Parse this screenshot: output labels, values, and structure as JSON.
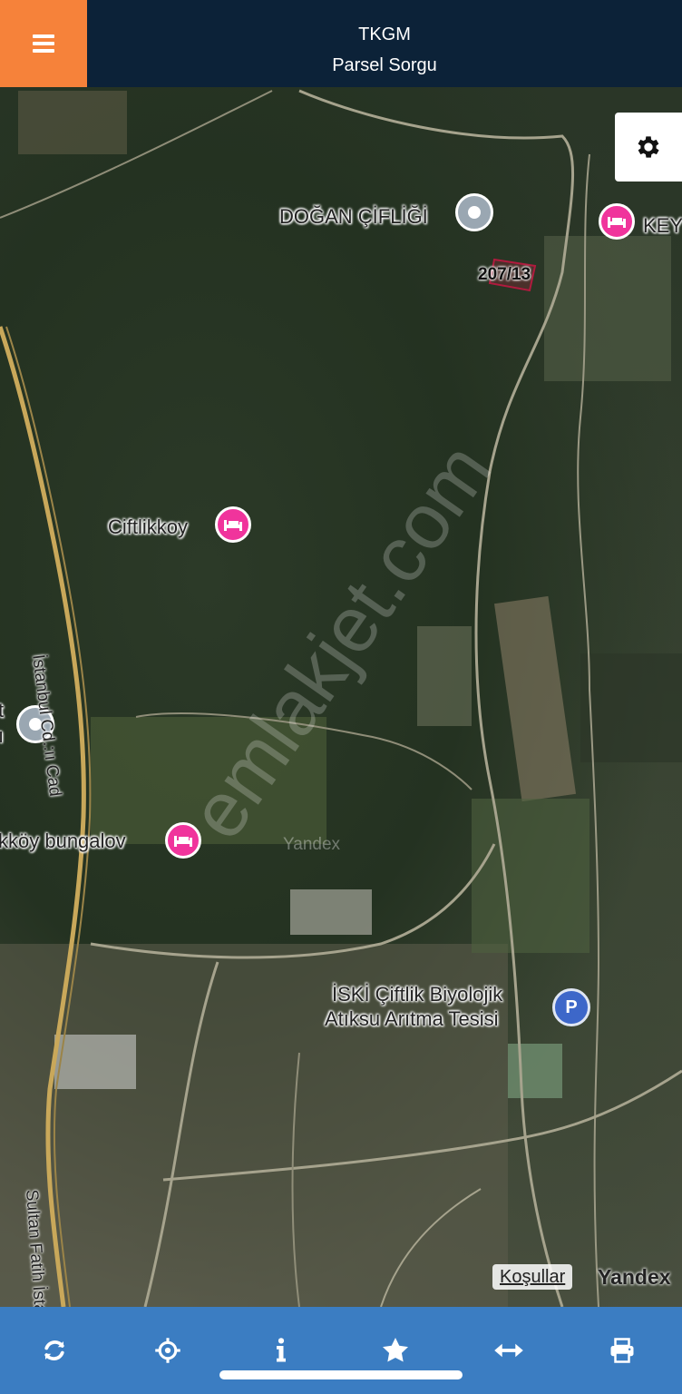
{
  "header": {
    "title": "TKGM",
    "subtitle": "Parsel Sorgu"
  },
  "map": {
    "labels": {
      "dogan": "DOĞAN ÇİFLİĞİ",
      "key": "KEY",
      "parcel": "207/13",
      "ciftlikkoy": "Ciftlikkoy",
      "bungalov": "kköy bungalov",
      "iski_line1": "İSKİ Çiftlik Biyolojik",
      "iski_line2": "Atıksu Arıtma Tesisi",
      "road_istanbul": "İstanbul Cd.:ıı Cad",
      "road_sultan": "Sultan Fatih İstanbul Cd.",
      "left_pin_label_1": "t",
      "left_pin_label_2": "ı",
      "park_letter": "P"
    },
    "watermark": "emlakjet.com",
    "yandex_watermark": "Yandex",
    "terms": "Koşullar",
    "provider": "Yandex"
  },
  "colors": {
    "header": "#0c2238",
    "menu": "#f6823a",
    "toolbar": "#3b7dc2",
    "hotel_pin": "#f0349c",
    "parking_pin": "#3d67c9"
  },
  "toolbar": {
    "icons": [
      "refresh-icon",
      "crosshair-icon",
      "info-icon",
      "star-icon",
      "measure-icon",
      "print-icon"
    ]
  }
}
